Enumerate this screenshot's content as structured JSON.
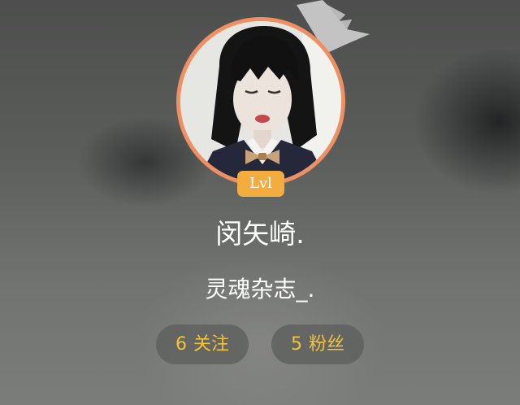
{
  "profile": {
    "level": "Lvl",
    "name": "闵矢崎.",
    "signature": "灵魂杂志_.",
    "following": {
      "count": "6",
      "label": "关注"
    },
    "followers": {
      "count": "5",
      "label": "粉丝"
    }
  },
  "icons": {
    "crown": "crown-icon",
    "avatar": "user-avatar"
  },
  "colors": {
    "avatar_ring": "#ef8f62",
    "level_badge": "#f2ad3e",
    "stat_text": "#f3c13a",
    "text": "#ffffff"
  }
}
